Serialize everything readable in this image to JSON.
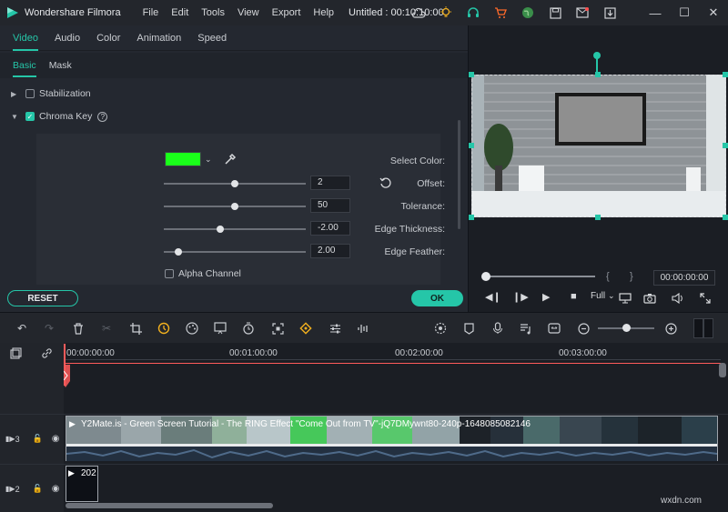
{
  "app": {
    "name": "Wondershare Filmora",
    "menu": [
      "File",
      "Edit",
      "Tools",
      "View",
      "Export",
      "Help"
    ],
    "document_title": "Untitled : 00:10:10:00"
  },
  "editor": {
    "tabs": [
      "Video",
      "Audio",
      "Color",
      "Animation",
      "Speed"
    ],
    "subtabs": [
      "Basic",
      "Mask"
    ],
    "stabilization_label": "Stabilization",
    "chroma_key_label": "Chroma Key",
    "params": {
      "select_color_label": "Select Color:",
      "select_color_value": "#1aff1a",
      "offset_label": "Offset:",
      "offset_value": "2",
      "offset_fraction": 0.5,
      "tolerance_label": "Tolerance:",
      "tolerance_value": "50",
      "tolerance_fraction": 0.5,
      "edge_thickness_label": "Edge Thickness:",
      "edge_thickness_value": "-2.00",
      "edge_thickness_fraction": 0.4,
      "edge_feather_label": "Edge Feather:",
      "edge_feather_value": "2.00",
      "edge_feather_fraction": 0.1,
      "alpha_channel_label": "Alpha Channel"
    },
    "reset_label": "RESET",
    "ok_label": "OK"
  },
  "preview": {
    "timecode": "00:00:00:00",
    "quality": "Full",
    "bracket_open": "{",
    "bracket_close": "}"
  },
  "timeline": {
    "ticks": [
      "00:00:00:00",
      "00:01:00:00",
      "00:02:00:00",
      "00:03:00:00"
    ],
    "tracks": [
      {
        "label": "3",
        "clip_title": "Y2Mate.is - Green Screen Tutorial - The RING Effect \"Come Out from TV\"-jQ7DMywnt80-240p-1648085082146"
      },
      {
        "label": "2",
        "clip_title": "202"
      }
    ]
  },
  "watermark": "wxdn.com",
  "colors": {
    "accent": "#25c6a8",
    "panel": "#242830",
    "background": "#1b1e24"
  }
}
